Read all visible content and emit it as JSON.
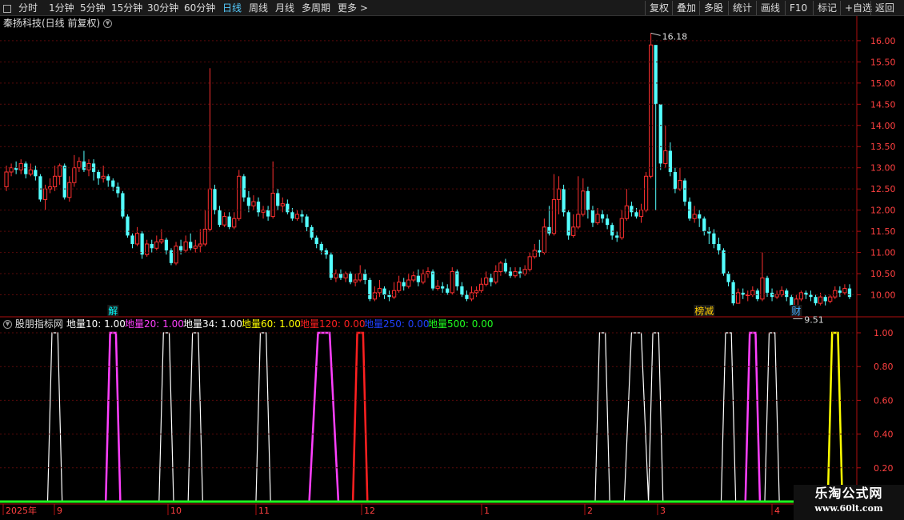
{
  "toolbar": {
    "left_items": [
      "分时",
      "1分钟",
      "5分钟",
      "15分钟",
      "30分钟",
      "60分钟",
      "日线",
      "周线",
      "月线",
      "多周期",
      "更多 >"
    ],
    "active": "日线",
    "right_items": [
      "复权",
      "叠加",
      "多股",
      "统计",
      "画线",
      "F10",
      "标记",
      "+自选",
      "返回"
    ]
  },
  "stock": {
    "title": "秦扬科技(日线 前复权)"
  },
  "price_axis": {
    "min": 9.5,
    "max": 16.3,
    "ticks": [
      "16.00",
      "15.50",
      "15.00",
      "14.50",
      "14.00",
      "13.50",
      "13.00",
      "12.50",
      "12.00",
      "11.50",
      "11.00",
      "10.50",
      "10.00"
    ]
  },
  "annotations": {
    "high_label": "16.18",
    "low_label": "9.51",
    "markers": [
      "解",
      "榜减",
      "财"
    ]
  },
  "indicator": {
    "name": "股朋指标网",
    "labels": [
      {
        "text": "地量10: 1.00",
        "color": "#ffffff"
      },
      {
        "text": "地量20: 1.00",
        "color": "#ff40ff"
      },
      {
        "text": "地量34: 1.00",
        "color": "#ffffff"
      },
      {
        "text": "地量60: 1.00",
        "color": "#ffff00"
      },
      {
        "text": "地量120: 0.00",
        "color": "#ff2020"
      },
      {
        "text": "地量250: 0.00",
        "color": "#2040ff"
      },
      {
        "text": "地量500: 0.00",
        "color": "#20ff20"
      }
    ],
    "axis_ticks": [
      "1.00",
      "0.80",
      "0.60",
      "0.40",
      "0.20"
    ]
  },
  "time_axis": {
    "labels": [
      "2025年",
      "9",
      "10",
      "11",
      "12",
      "1",
      "2",
      "3",
      "4"
    ]
  },
  "watermark": {
    "title": "乐淘公式网",
    "url": "www.60lt.com"
  },
  "chart_data": {
    "type": "candlestick",
    "up_color": "#ff3030",
    "down_color": "#54ffff",
    "candles": [
      [
        12.55,
        12.9,
        13.05,
        12.45
      ],
      [
        12.9,
        13.0,
        13.1,
        12.8
      ],
      [
        13.0,
        12.95,
        13.15,
        12.85
      ],
      [
        12.95,
        13.1,
        13.2,
        12.85
      ],
      [
        13.1,
        12.85,
        13.15,
        12.75
      ],
      [
        12.85,
        12.95,
        13.1,
        12.8
      ],
      [
        12.95,
        12.8,
        13.05,
        12.7
      ],
      [
        12.8,
        12.25,
        12.85,
        12.2
      ],
      [
        12.25,
        12.5,
        12.6,
        12.0
      ],
      [
        12.5,
        12.55,
        12.75,
        12.4
      ],
      [
        12.55,
        12.8,
        13.05,
        12.45
      ],
      [
        12.8,
        13.05,
        13.1,
        12.6
      ],
      [
        13.05,
        12.3,
        13.1,
        12.25
      ],
      [
        12.3,
        12.65,
        12.8,
        12.2
      ],
      [
        12.65,
        13.0,
        13.3,
        12.55
      ],
      [
        13.0,
        13.15,
        13.25,
        12.9
      ],
      [
        13.15,
        12.95,
        13.4,
        12.9
      ],
      [
        12.95,
        13.1,
        13.2,
        12.8
      ],
      [
        13.1,
        12.9,
        13.2,
        12.7
      ],
      [
        12.9,
        12.75,
        12.95,
        12.6
      ],
      [
        12.75,
        12.8,
        13.05,
        12.65
      ],
      [
        12.8,
        12.7,
        12.85,
        12.55
      ],
      [
        12.7,
        12.55,
        12.75,
        12.45
      ],
      [
        12.55,
        12.4,
        12.65,
        12.3
      ],
      [
        12.4,
        11.85,
        12.45,
        11.8
      ],
      [
        11.85,
        11.4,
        11.9,
        11.35
      ],
      [
        11.4,
        11.2,
        11.45,
        11.1
      ],
      [
        11.2,
        11.45,
        11.6,
        11.15
      ],
      [
        11.45,
        10.95,
        11.5,
        10.85
      ],
      [
        10.95,
        11.2,
        11.3,
        10.9
      ],
      [
        11.2,
        11.1,
        11.3,
        11.0
      ],
      [
        11.1,
        11.25,
        11.4,
        11.05
      ],
      [
        11.25,
        11.3,
        11.55,
        11.2
      ],
      [
        11.3,
        11.05,
        11.35,
        10.95
      ],
      [
        11.05,
        10.75,
        11.1,
        10.7
      ],
      [
        10.75,
        11.15,
        11.25,
        10.7
      ],
      [
        11.15,
        11.05,
        11.3,
        10.95
      ],
      [
        11.05,
        11.25,
        11.4,
        11.0
      ],
      [
        11.25,
        11.1,
        11.45,
        11.05
      ],
      [
        11.1,
        11.15,
        11.3,
        11.0
      ],
      [
        11.15,
        11.2,
        11.55,
        11.0
      ],
      [
        11.2,
        11.55,
        12.0,
        11.15
      ],
      [
        11.55,
        12.5,
        15.35,
        11.5
      ],
      [
        12.5,
        12.0,
        12.6,
        11.9
      ],
      [
        12.0,
        11.65,
        12.1,
        11.6
      ],
      [
        11.65,
        11.85,
        11.95,
        11.6
      ],
      [
        11.85,
        11.6,
        11.95,
        11.55
      ],
      [
        11.6,
        11.8,
        11.95,
        11.55
      ],
      [
        11.8,
        12.8,
        12.95,
        11.75
      ],
      [
        12.8,
        12.3,
        12.85,
        12.2
      ],
      [
        12.3,
        12.1,
        12.45,
        11.95
      ],
      [
        12.1,
        12.2,
        12.35,
        12.0
      ],
      [
        12.2,
        11.95,
        12.3,
        11.85
      ],
      [
        11.95,
        12.0,
        12.1,
        11.8
      ],
      [
        12.0,
        11.85,
        12.1,
        11.75
      ],
      [
        11.85,
        12.4,
        13.15,
        11.8
      ],
      [
        12.4,
        12.1,
        12.5,
        12.0
      ],
      [
        12.1,
        12.15,
        12.3,
        11.95
      ],
      [
        12.15,
        11.95,
        12.25,
        11.9
      ],
      [
        11.95,
        11.8,
        12.05,
        11.75
      ],
      [
        11.8,
        11.9,
        12.0,
        11.75
      ],
      [
        11.9,
        11.85,
        12.0,
        11.7
      ],
      [
        11.85,
        11.6,
        11.9,
        11.5
      ],
      [
        11.6,
        11.35,
        11.65,
        11.3
      ],
      [
        11.35,
        11.2,
        11.4,
        11.1
      ],
      [
        11.2,
        11.05,
        11.25,
        10.95
      ],
      [
        11.05,
        10.95,
        11.1,
        10.85
      ],
      [
        10.95,
        10.4,
        11.0,
        10.35
      ],
      [
        10.4,
        10.5,
        10.6,
        10.3
      ],
      [
        10.5,
        10.4,
        10.6,
        10.35
      ],
      [
        10.4,
        10.5,
        10.55,
        10.3
      ],
      [
        10.5,
        10.3,
        10.55,
        10.25
      ],
      [
        10.3,
        10.35,
        10.5,
        10.2
      ],
      [
        10.35,
        10.5,
        10.7,
        10.3
      ],
      [
        10.5,
        10.35,
        10.6,
        10.25
      ],
      [
        10.35,
        9.9,
        10.4,
        9.85
      ],
      [
        9.9,
        10.05,
        10.2,
        9.85
      ],
      [
        10.05,
        10.15,
        10.35,
        9.95
      ],
      [
        10.15,
        10.0,
        10.2,
        9.9
      ],
      [
        10.0,
        9.95,
        10.1,
        9.85
      ],
      [
        9.95,
        10.1,
        10.3,
        9.9
      ],
      [
        10.1,
        10.3,
        10.45,
        10.05
      ],
      [
        10.3,
        10.2,
        10.4,
        10.1
      ],
      [
        10.2,
        10.35,
        10.5,
        10.15
      ],
      [
        10.35,
        10.45,
        10.55,
        10.3
      ],
      [
        10.45,
        10.3,
        10.6,
        10.2
      ],
      [
        10.3,
        10.5,
        10.6,
        10.25
      ],
      [
        10.5,
        10.55,
        10.65,
        10.4
      ],
      [
        10.55,
        10.15,
        10.6,
        10.1
      ],
      [
        10.15,
        10.2,
        10.35,
        10.1
      ],
      [
        10.2,
        10.15,
        10.3,
        10.05
      ],
      [
        10.15,
        10.05,
        10.25,
        10.0
      ],
      [
        10.05,
        10.55,
        10.65,
        10.0
      ],
      [
        10.55,
        10.2,
        10.6,
        10.1
      ],
      [
        10.2,
        10.0,
        10.3,
        9.95
      ],
      [
        10.0,
        9.9,
        10.1,
        9.85
      ],
      [
        9.9,
        10.05,
        10.2,
        9.85
      ],
      [
        10.05,
        10.1,
        10.2,
        9.95
      ],
      [
        10.1,
        10.25,
        10.4,
        10.05
      ],
      [
        10.25,
        10.4,
        10.55,
        10.2
      ],
      [
        10.4,
        10.3,
        10.5,
        10.2
      ],
      [
        10.3,
        10.55,
        10.7,
        10.25
      ],
      [
        10.55,
        10.75,
        10.8,
        10.45
      ],
      [
        10.75,
        10.55,
        10.85,
        10.5
      ],
      [
        10.55,
        10.45,
        10.65,
        10.4
      ],
      [
        10.45,
        10.55,
        10.65,
        10.4
      ],
      [
        10.55,
        10.5,
        10.65,
        10.4
      ],
      [
        10.5,
        10.6,
        10.7,
        10.45
      ],
      [
        10.6,
        10.9,
        11.0,
        10.55
      ],
      [
        10.9,
        11.05,
        11.2,
        10.85
      ],
      [
        11.05,
        11.0,
        11.3,
        10.9
      ],
      [
        11.0,
        11.6,
        11.8,
        10.95
      ],
      [
        11.6,
        11.45,
        12.1,
        11.4
      ],
      [
        11.45,
        12.25,
        12.85,
        11.4
      ],
      [
        12.25,
        12.5,
        12.8,
        11.9
      ],
      [
        12.5,
        11.95,
        12.6,
        11.85
      ],
      [
        11.95,
        11.4,
        12.0,
        11.3
      ],
      [
        11.4,
        11.6,
        11.9,
        11.35
      ],
      [
        11.6,
        11.9,
        12.8,
        11.55
      ],
      [
        11.9,
        12.45,
        12.75,
        11.85
      ],
      [
        12.45,
        12.0,
        12.55,
        11.8
      ],
      [
        12.0,
        11.7,
        12.1,
        11.6
      ],
      [
        11.7,
        11.9,
        12.05,
        11.65
      ],
      [
        11.9,
        11.8,
        12.0,
        11.7
      ],
      [
        11.8,
        11.65,
        11.9,
        11.55
      ],
      [
        11.65,
        11.4,
        11.7,
        11.3
      ],
      [
        11.4,
        11.35,
        11.5,
        11.25
      ],
      [
        11.35,
        11.8,
        12.0,
        11.3
      ],
      [
        11.8,
        12.1,
        12.5,
        11.75
      ],
      [
        12.1,
        11.95,
        12.2,
        11.85
      ],
      [
        11.95,
        11.85,
        12.05,
        11.8
      ],
      [
        11.85,
        12.0,
        12.15,
        11.7
      ],
      [
        12.0,
        12.8,
        12.9,
        11.95
      ],
      [
        12.8,
        15.9,
        16.18,
        12.75
      ],
      [
        15.9,
        14.5,
        14.7,
        12.0
      ],
      [
        14.5,
        13.1,
        13.6,
        12.95
      ],
      [
        13.1,
        13.4,
        14.0,
        13.0
      ],
      [
        13.4,
        12.9,
        13.6,
        12.8
      ],
      [
        12.9,
        12.5,
        13.0,
        12.4
      ],
      [
        12.5,
        12.7,
        13.0,
        12.45
      ],
      [
        12.7,
        12.2,
        12.75,
        12.1
      ],
      [
        12.2,
        11.8,
        12.3,
        11.75
      ],
      [
        11.8,
        11.9,
        12.1,
        11.7
      ],
      [
        11.9,
        11.8,
        12.0,
        11.6
      ],
      [
        11.8,
        11.5,
        11.85,
        11.4
      ],
      [
        11.5,
        11.45,
        11.6,
        11.2
      ],
      [
        11.45,
        11.2,
        11.55,
        11.1
      ],
      [
        11.2,
        11.05,
        11.35,
        10.95
      ],
      [
        11.05,
        10.5,
        11.1,
        10.45
      ],
      [
        10.5,
        10.3,
        10.55,
        10.2
      ],
      [
        10.3,
        9.8,
        10.35,
        9.75
      ],
      [
        9.8,
        10.05,
        10.15,
        9.8
      ],
      [
        10.05,
        10.0,
        10.15,
        9.9
      ],
      [
        10.0,
        10.0,
        10.1,
        9.85
      ],
      [
        10.0,
        10.1,
        10.2,
        9.95
      ],
      [
        10.1,
        9.9,
        10.15,
        9.85
      ],
      [
        9.9,
        10.4,
        11.0,
        9.85
      ],
      [
        10.4,
        10.05,
        10.45,
        9.95
      ],
      [
        10.05,
        9.95,
        10.15,
        9.85
      ],
      [
        9.95,
        10.0,
        10.1,
        9.9
      ],
      [
        10.0,
        10.1,
        10.2,
        9.95
      ],
      [
        10.1,
        9.95,
        10.15,
        9.85
      ],
      [
        9.95,
        9.75,
        10.0,
        9.51
      ],
      [
        9.75,
        9.9,
        10.0,
        9.7
      ],
      [
        9.9,
        10.05,
        10.1,
        9.85
      ],
      [
        10.05,
        10.0,
        10.1,
        9.9
      ],
      [
        10.0,
        9.95,
        10.1,
        9.85
      ],
      [
        9.95,
        9.8,
        10.0,
        9.75
      ],
      [
        9.8,
        9.95,
        10.05,
        9.75
      ],
      [
        9.95,
        9.85,
        10.0,
        9.75
      ],
      [
        9.85,
        9.95,
        10.0,
        9.8
      ],
      [
        9.95,
        10.1,
        10.2,
        9.9
      ],
      [
        10.1,
        10.05,
        10.2,
        9.95
      ],
      [
        10.05,
        10.15,
        10.25,
        10.0
      ],
      [
        10.15,
        9.95,
        10.25,
        9.9
      ]
    ],
    "indicator_series": [
      {
        "name": "地量10",
        "color": "#ffffff",
        "pulses": [
          [
            9,
            11
          ],
          [
            32,
            34
          ],
          [
            52,
            54
          ],
          [
            122,
            124
          ],
          [
            128,
            132
          ],
          [
            133,
            135
          ],
          [
            148,
            150
          ]
        ]
      },
      {
        "name": "地量20",
        "color": "#ff40ff",
        "pulses": [
          [
            21,
            23
          ],
          [
            63,
            68
          ],
          [
            153,
            155
          ]
        ]
      },
      {
        "name": "地量34",
        "color": "#ffffff",
        "pulses": [
          [
            38,
            40
          ],
          [
            157,
            159
          ]
        ]
      },
      {
        "name": "地量60",
        "color": "#ffff00",
        "pulses": [
          [
            170,
            172
          ]
        ]
      },
      {
        "name": "地量120",
        "color": "#ff2020",
        "pulses": [
          [
            72,
            74
          ]
        ]
      }
    ]
  }
}
